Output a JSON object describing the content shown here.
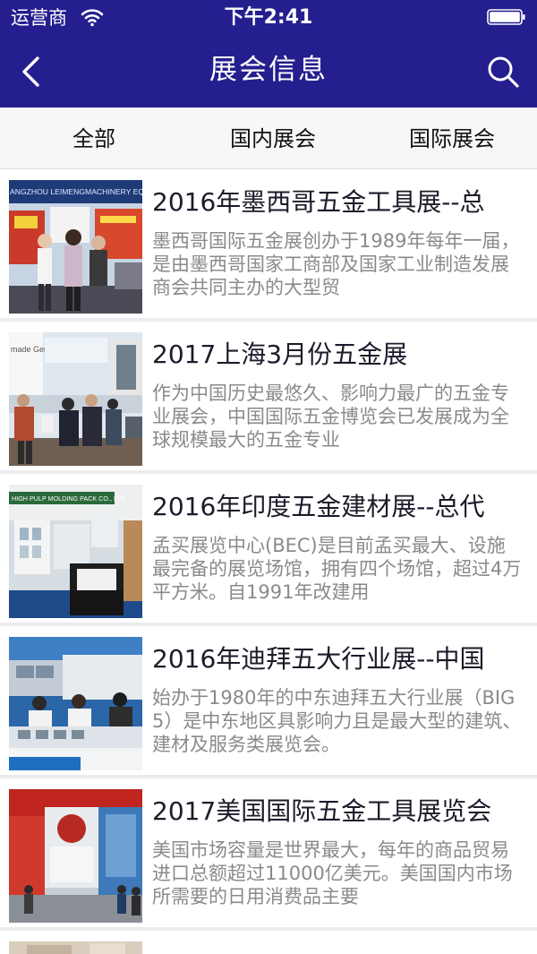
{
  "status_bar": {
    "carrier": "运营商",
    "time": "下午2:41"
  },
  "nav": {
    "title": "展会信息"
  },
  "tabs": [
    {
      "label": "全部"
    },
    {
      "label": "国内展会"
    },
    {
      "label": "国际展会"
    }
  ],
  "items": [
    {
      "title": "2016年墨西哥五金工具展--总",
      "desc": "墨西哥国际五金展创办于1989年每年一届，是由墨西哥国家工商部及国家工业制造发展商会共同主办的大型贸",
      "thumb_text": "ANGZHOU LEIMENGMACHINERY EQUIPMEN"
    },
    {
      "title": "2017上海3月份五金展",
      "desc": "作为中国历史最悠久、影响力最广的五金专业展会，中国国际五金博览会已发展成为全球规模最大的五金专业",
      "thumb_text": "made Germany"
    },
    {
      "title": "2016年印度五金建材展--总代",
      "desc": "孟买展览中心(BEC)是目前孟买最大、设施最完备的展览场馆，拥有四个场馆，超过4万平方米。自1991年改建用",
      "thumb_text": "HIGH PULP MOLDING PACK CO., LTD."
    },
    {
      "title": "2016年迪拜五大行业展--中国",
      "desc": "始办于1980年的中东迪拜五大行业展（BIG5）是中东地区具影响力且是最大型的建筑、建材及服务类展览会。",
      "thumb_text": ""
    },
    {
      "title": "2017美国国际五金工具展览会",
      "desc": "美国市场容量是世界最大，每年的商品贸易进口总额超过11000亿美元。美国国内市场所需要的日用消费品主要",
      "thumb_text": ""
    }
  ],
  "colors": {
    "header": "#251e8f",
    "title_text": "#1b1b2a",
    "desc_text": "#8a8a8a"
  }
}
